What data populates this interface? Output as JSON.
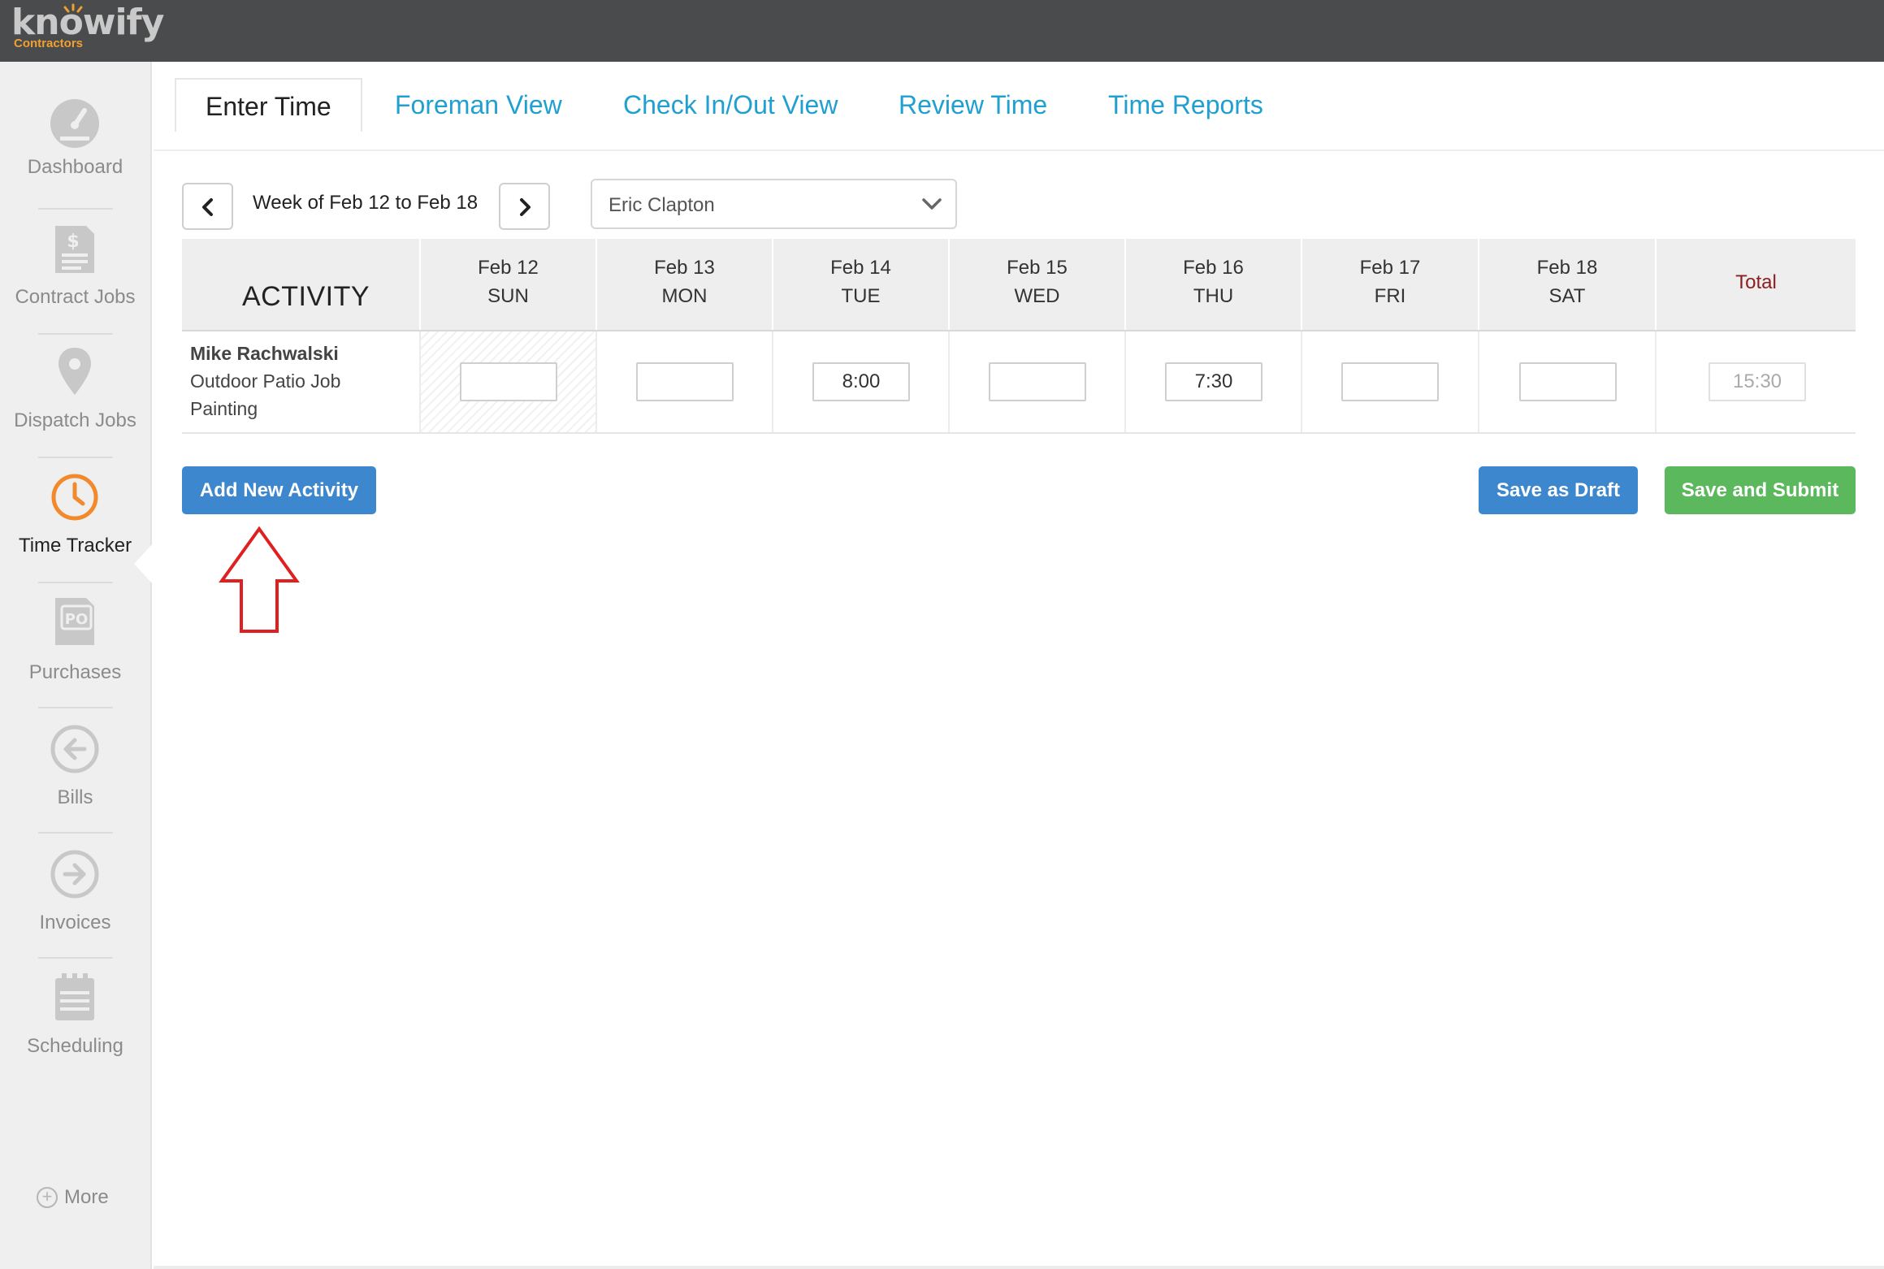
{
  "app": {
    "brand": "knowify",
    "brand_sub": "Contractors",
    "accent": "#f0a030"
  },
  "sidebar": {
    "items": [
      {
        "label": "Dashboard",
        "icon": "speedometer-icon",
        "active": false
      },
      {
        "label": "Contract Jobs",
        "icon": "contract-document-icon",
        "active": false
      },
      {
        "label": "Dispatch Jobs",
        "icon": "map-pin-icon",
        "active": false
      },
      {
        "label": "Time Tracker",
        "icon": "clock-icon",
        "active": true
      },
      {
        "label": "Purchases",
        "icon": "po-document-icon",
        "active": false
      },
      {
        "label": "Bills",
        "icon": "arrow-left-circle-icon",
        "active": false
      },
      {
        "label": "Invoices",
        "icon": "arrow-right-circle-icon",
        "active": false
      },
      {
        "label": "Scheduling",
        "icon": "calendar-icon",
        "active": false
      }
    ],
    "more_label": "More"
  },
  "tabs": [
    {
      "label": "Enter Time",
      "active": true
    },
    {
      "label": "Foreman View",
      "active": false
    },
    {
      "label": "Check In/Out View",
      "active": false
    },
    {
      "label": "Review Time",
      "active": false
    },
    {
      "label": "Time Reports",
      "active": false
    }
  ],
  "week": {
    "label": "Week of Feb 12 to Feb 18"
  },
  "employee_select": {
    "value": "Eric Clapton"
  },
  "grid": {
    "activity_header": "ACTIVITY",
    "total_header": "Total",
    "days": [
      {
        "date": "Feb 12",
        "dow": "SUN"
      },
      {
        "date": "Feb 13",
        "dow": "MON"
      },
      {
        "date": "Feb 14",
        "dow": "TUE"
      },
      {
        "date": "Feb 15",
        "dow": "WED"
      },
      {
        "date": "Feb 16",
        "dow": "THU"
      },
      {
        "date": "Feb 17",
        "dow": "FRI"
      },
      {
        "date": "Feb 18",
        "dow": "SAT"
      }
    ],
    "rows": [
      {
        "employee": "Mike Rachwalski",
        "job": "Outdoor Patio Job",
        "task": "Painting",
        "hours": [
          "",
          "",
          "8:00",
          "",
          "7:30",
          "",
          ""
        ],
        "total": "15:30"
      }
    ]
  },
  "actions": {
    "add_activity": "Add New Activity",
    "save_draft": "Save as Draft",
    "save_submit": "Save and Submit"
  },
  "colors": {
    "topbar": "#4a4b4d",
    "link_blue": "#1fa0d0",
    "primary_button": "#3d87cf",
    "success_button": "#5cb85c",
    "total_header": "#8b1e1e",
    "active_icon": "#f08a2c",
    "annotation_arrow": "#e02020"
  }
}
